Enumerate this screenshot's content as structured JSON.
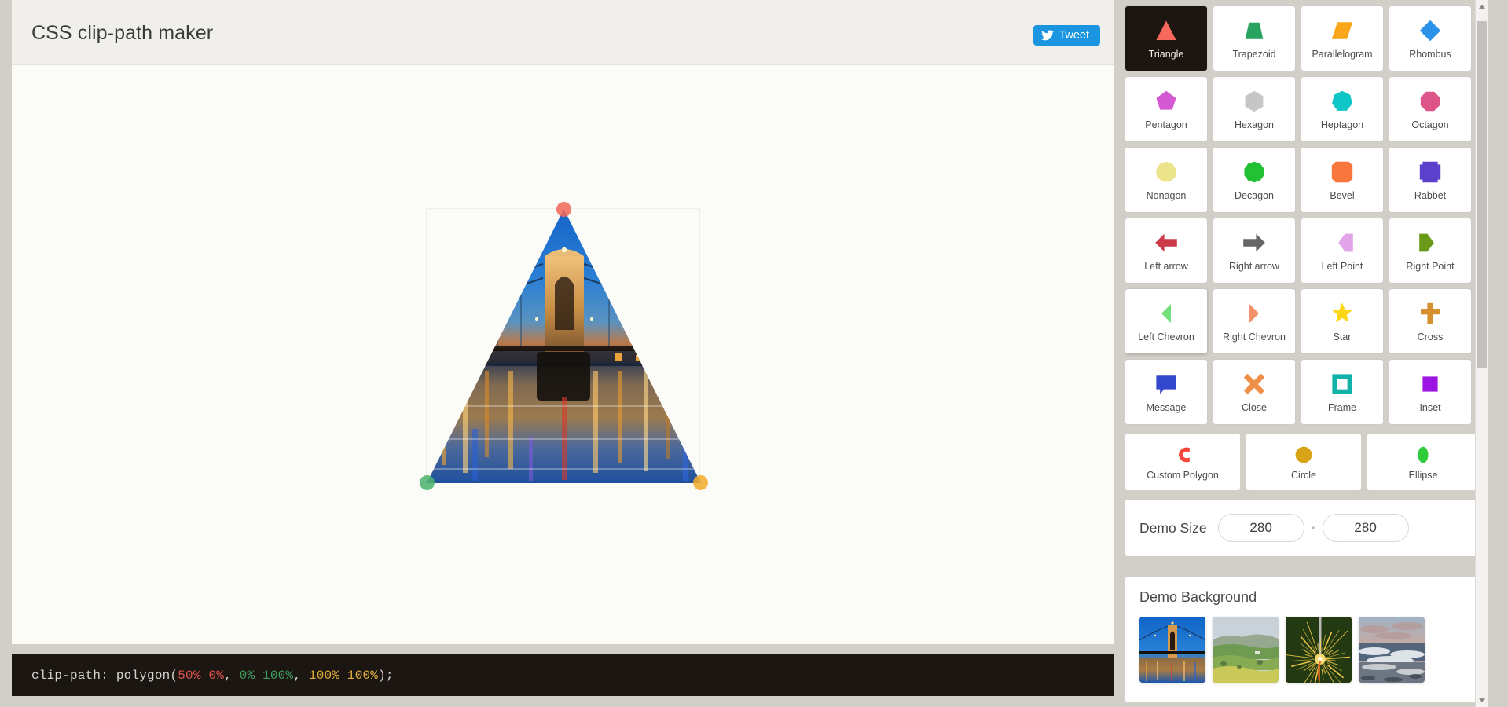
{
  "header": {
    "title": "CSS clip-path maker",
    "tweet_label": "Tweet",
    "tweet_color": "#1b95e0",
    "bird_icon": "twitter-bird-icon"
  },
  "code": {
    "prefix": "clip-path: polygon(",
    "point0": "50% 0%",
    "sep0": ", ",
    "point1": "0% 100%",
    "sep1": ", ",
    "point2": "100% 100%",
    "suffix": ");",
    "point0_color": "#d9544d",
    "point1_color": "#3f9e5e",
    "point2_color": "#e3b23c",
    "background": "#1c1613"
  },
  "demo": {
    "clip_path": "polygon(50% 0%, 0% 100%, 100% 100%)",
    "background_image": "bridge-night-thumbnail",
    "handles": [
      {
        "name": "handle-top-vertex",
        "color": "#f26b5b"
      },
      {
        "name": "handle-bottom-left-vertex",
        "color": "#4cb46c"
      },
      {
        "name": "handle-bottom-right-vertex",
        "color": "#f0ad2e"
      }
    ]
  },
  "shapes": [
    {
      "label": "Triangle",
      "icon": "triangle-icon",
      "color": "#f8695c",
      "selected": true,
      "hovered": false
    },
    {
      "label": "Trapezoid",
      "icon": "trapezoid-icon",
      "color": "#27a35f",
      "selected": false,
      "hovered": false
    },
    {
      "label": "Parallelogram",
      "icon": "parallelogram-icon",
      "color": "#faa61a",
      "selected": false,
      "hovered": false
    },
    {
      "label": "Rhombus",
      "icon": "rhombus-icon",
      "color": "#2a92e8",
      "selected": false,
      "hovered": false
    },
    {
      "label": "Pentagon",
      "icon": "pentagon-icon",
      "color": "#d45ad4",
      "selected": false,
      "hovered": false
    },
    {
      "label": "Hexagon",
      "icon": "hexagon-icon",
      "color": "#c6c6c6",
      "selected": false,
      "hovered": false
    },
    {
      "label": "Heptagon",
      "icon": "heptagon-icon",
      "color": "#0ec6c6",
      "selected": false,
      "hovered": false
    },
    {
      "label": "Octagon",
      "icon": "octagon-icon",
      "color": "#dd5588",
      "selected": false,
      "hovered": false
    },
    {
      "label": "Nonagon",
      "icon": "nonagon-icon",
      "color": "#ece48a",
      "selected": false,
      "hovered": false
    },
    {
      "label": "Decagon",
      "icon": "decagon-icon",
      "color": "#22c034",
      "selected": false,
      "hovered": false
    },
    {
      "label": "Bevel",
      "icon": "bevel-icon",
      "color": "#f9773f",
      "selected": false,
      "hovered": false
    },
    {
      "label": "Rabbet",
      "icon": "rabbet-icon",
      "color": "#5b40cc",
      "selected": false,
      "hovered": false
    },
    {
      "label": "Left arrow",
      "icon": "left-arrow-icon",
      "color": "#cc3a4a",
      "selected": false,
      "hovered": false
    },
    {
      "label": "Right arrow",
      "icon": "right-arrow-icon",
      "color": "#666666",
      "selected": false,
      "hovered": false
    },
    {
      "label": "Left Point",
      "icon": "left-point-icon",
      "color": "#e3a3e8",
      "selected": false,
      "hovered": false
    },
    {
      "label": "Right Point",
      "icon": "right-point-icon",
      "color": "#6a9a18",
      "selected": false,
      "hovered": false
    },
    {
      "label": "Left Chevron",
      "icon": "left-chevron-icon",
      "color": "#72e07a",
      "selected": false,
      "hovered": true
    },
    {
      "label": "Right Chevron",
      "icon": "right-chevron-icon",
      "color": "#f2906a",
      "selected": false,
      "hovered": false
    },
    {
      "label": "Star",
      "icon": "star-icon",
      "color": "#fcd716",
      "selected": false,
      "hovered": false
    },
    {
      "label": "Cross",
      "icon": "cross-icon",
      "color": "#d7902f",
      "selected": false,
      "hovered": false
    },
    {
      "label": "Message",
      "icon": "message-icon",
      "color": "#3348cc",
      "selected": false,
      "hovered": false
    },
    {
      "label": "Close",
      "icon": "close-icon",
      "color": "#ef8f48",
      "selected": false,
      "hovered": false
    },
    {
      "label": "Frame",
      "icon": "frame-icon",
      "color": "#11b2a8",
      "selected": false,
      "hovered": false
    },
    {
      "label": "Inset",
      "icon": "inset-icon",
      "color": "#9b16e0",
      "selected": false,
      "hovered": false
    }
  ],
  "curves": [
    {
      "label": "Custom Polygon",
      "icon": "custom-polygon-icon",
      "color": "#f5483b"
    },
    {
      "label": "Circle",
      "icon": "circle-icon",
      "color": "#d9a318"
    },
    {
      "label": "Ellipse",
      "icon": "ellipse-icon",
      "color": "#2fcb3a"
    }
  ],
  "demo_size": {
    "label": "Demo Size",
    "width_value": "280",
    "height_value": "280",
    "width_placeholder": "280",
    "height_placeholder": "280",
    "separator": "×"
  },
  "demo_background": {
    "title": "Demo Background",
    "thumbs": [
      {
        "name": "bridge-night-thumbnail",
        "alt": "Illuminated suspension bridge at dusk reflected in river"
      },
      {
        "name": "countryside-thumbnail",
        "alt": "Green rolling hills and farm fields"
      },
      {
        "name": "sparkler-thumbnail",
        "alt": "Sparkler firework bursting on dark green background"
      },
      {
        "name": "beach-waves-thumbnail",
        "alt": "Ocean waves breaking on a beach at dusk"
      }
    ],
    "selected_index": 0
  },
  "scrollbar": {
    "up_icon": "scroll-up-arrow-icon",
    "down_icon": "scroll-down-arrow-icon",
    "thumb_top_pct": 3,
    "thumb_height_pct": 49
  }
}
